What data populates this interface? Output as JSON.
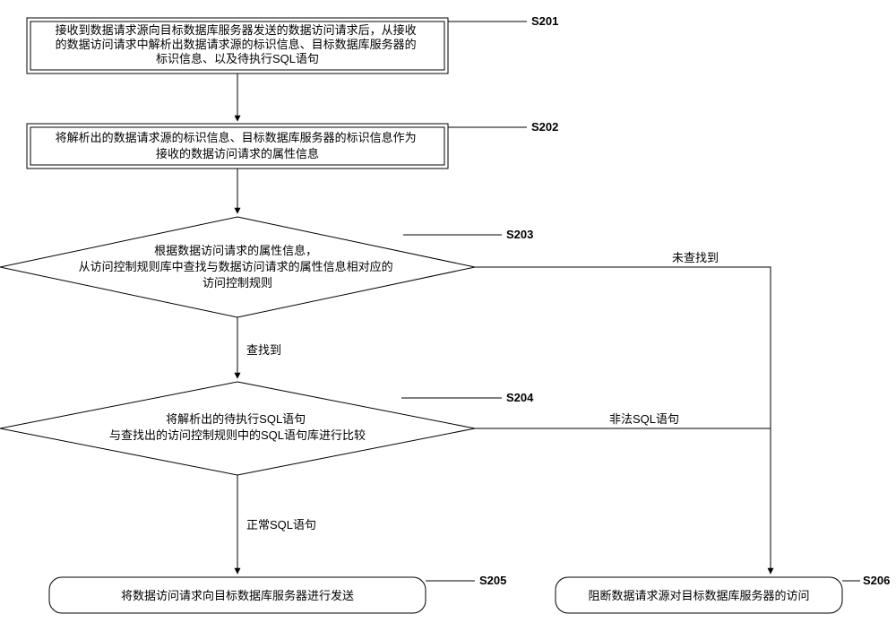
{
  "chart_data": {
    "type": "flowchart",
    "nodes": [
      {
        "id": "S201",
        "step": "S201",
        "shape": "rect-double",
        "lines": [
          "接收到数据请求源向目标数据库服务器发送的数据访问请求后，从接收",
          "的数据访问请求中解析出数据请求源的标识信息、目标数据库服务器的",
          "标识信息、以及待执行SQL语句"
        ]
      },
      {
        "id": "S202",
        "step": "S202",
        "shape": "rect-double",
        "lines": [
          "将解析出的数据请求源的标识信息、目标数据库服务器的标识信息作为",
          "接收的数据访问请求的属性信息"
        ]
      },
      {
        "id": "S203",
        "step": "S203",
        "shape": "diamond",
        "lines": [
          "根据数据访问请求的属性信息，",
          "从访问控制规则库中查找与数据访问请求的属性信息相对应的",
          "访问控制规则"
        ]
      },
      {
        "id": "S204",
        "step": "S204",
        "shape": "diamond",
        "lines": [
          "将解析出的待执行SQL语句",
          "与查找出的访问控制规则中的SQL语句库进行比较"
        ]
      },
      {
        "id": "S205",
        "step": "S205",
        "shape": "rounded",
        "lines": [
          "将数据访问请求向目标数据库服务器进行发送"
        ]
      },
      {
        "id": "S206",
        "step": "S206",
        "shape": "rounded",
        "lines": [
          "阻断数据请求源对目标数据库服务器的访问"
        ]
      }
    ],
    "edges": [
      {
        "from": "S201",
        "to": "S202",
        "label": ""
      },
      {
        "from": "S202",
        "to": "S203",
        "label": ""
      },
      {
        "from": "S203",
        "to": "S204",
        "label": "查找到"
      },
      {
        "from": "S203",
        "to": "S206",
        "label": "未查找到"
      },
      {
        "from": "S204",
        "to": "S205",
        "label": "正常SQL语句"
      },
      {
        "from": "S204",
        "to": "S206",
        "label": "非法SQL语句"
      }
    ]
  }
}
